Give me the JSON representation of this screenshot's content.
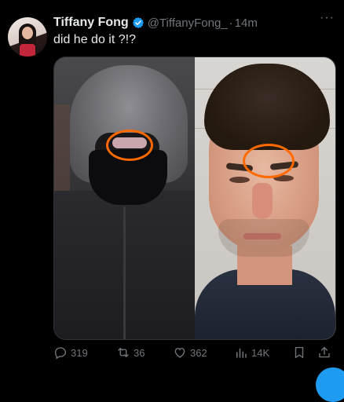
{
  "tweet": {
    "display_name": "Tiffany Fong",
    "handle": "@TiffanyFong_",
    "separator": "·",
    "time": "14m",
    "text": "did he do it ?!?",
    "more": "···"
  },
  "actions": {
    "replies": "319",
    "retweets": "36",
    "likes": "362",
    "views": "14K"
  },
  "colors": {
    "background": "#000000",
    "verified": "#1d9bf0",
    "annotation": "#ff6a00",
    "muted": "#71767b"
  },
  "icons": [
    "verified-badge-icon",
    "more-icon",
    "reply-icon",
    "retweet-icon",
    "like-icon",
    "views-icon",
    "bookmark-icon",
    "share-icon"
  ]
}
